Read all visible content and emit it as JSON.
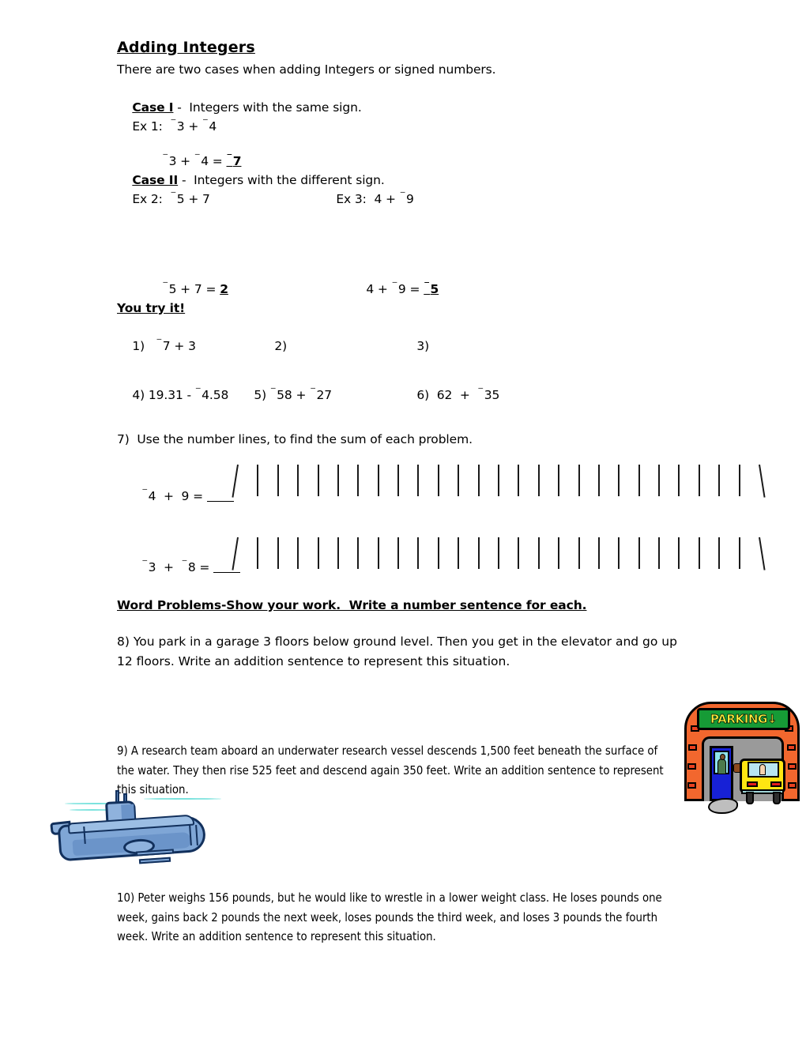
{
  "document": {
    "title": "Adding Integers",
    "intro": "There are two cases when adding Integers or signed numbers."
  },
  "case1": {
    "label": "Case I",
    "desc": " -  Integers with the same sign.",
    "example_label": "Ex 1:",
    "example": "⁻3 + ⁻4",
    "worked": "⁻3 + ⁻4 = ",
    "answer": "⁻7"
  },
  "case2": {
    "label": "Case II",
    "desc": " -  Integers with the different sign.",
    "ex2_label": "Ex 2:",
    "ex2": "⁻5 + 7",
    "ex3_label": "Ex 3:",
    "ex3": "4 + ⁻9",
    "ex2_worked": "⁻5 + 7 = ",
    "ex2_answer": "2",
    "ex3_worked": "4 + ⁻9 = ",
    "ex3_answer": "⁻5"
  },
  "practice": {
    "heading": "You try it!",
    "items": [
      {
        "number": "1)",
        "problem": "⁻7 + 3"
      },
      {
        "number": "2)",
        "problem": ""
      },
      {
        "number": "3)",
        "problem": ""
      },
      {
        "number": "4)",
        "problem": "19.31 - ⁻4.58"
      },
      {
        "number": "5)",
        "problem": "⁻58 + ⁻27"
      },
      {
        "number": "6)",
        "problem": "62  +  ⁻35"
      }
    ]
  },
  "numberline_problem": {
    "instruction": "7)  Use the number lines, to find the sum of each problem.",
    "lines": [
      {
        "expression": "⁻4  +  9 = ",
        "tick_count": 27
      },
      {
        "expression": "⁻3  +  ⁻8 = ",
        "tick_count": 27
      }
    ]
  },
  "word_problems": {
    "heading": "Word Problems-Show your work.  Write a number sentence for each.",
    "items": [
      {
        "number": "8)",
        "text": "You park in a garage 3 floors below ground level.  Then you get in the elevator and go up 12 floors.  Write an addition sentence to represent this situation."
      },
      {
        "number": "9)",
        "text": "A research team aboard an underwater research vessel descends 1,500 feet beneath the surface of the water.  They then rise 525 feet and descend again 350 feet.  Write an addition sentence to represent this situation."
      },
      {
        "number": "10)",
        "text": "Peter weighs 156 pounds, but he would like to wrestle in a lower weight class.  He loses pounds one week, gains back 2 pounds the next week,  loses pounds the third week, and loses 3 pounds the fourth week.  Write an addition sentence to represent this situation."
      }
    ]
  },
  "clipart": {
    "parking": {
      "name": "parking-garage-clipart",
      "sign_text": "PARKING↓",
      "colors": {
        "arch": "#F2672E",
        "brick": "#E8401F",
        "sign": "#169B36",
        "sign_text": "#FFF23D",
        "interior": "#9A9A9A",
        "booth": "#1721D6",
        "car": "#FFE512",
        "taillight": "#E31B1B",
        "smoke": "#BEBEBE"
      }
    },
    "submarine": {
      "name": "submarine-clipart",
      "colors": {
        "hull": "#7FA6D6",
        "hull_shade": "#6B94C9",
        "outline": "#12305C",
        "water": "#7CE3DE"
      }
    }
  }
}
